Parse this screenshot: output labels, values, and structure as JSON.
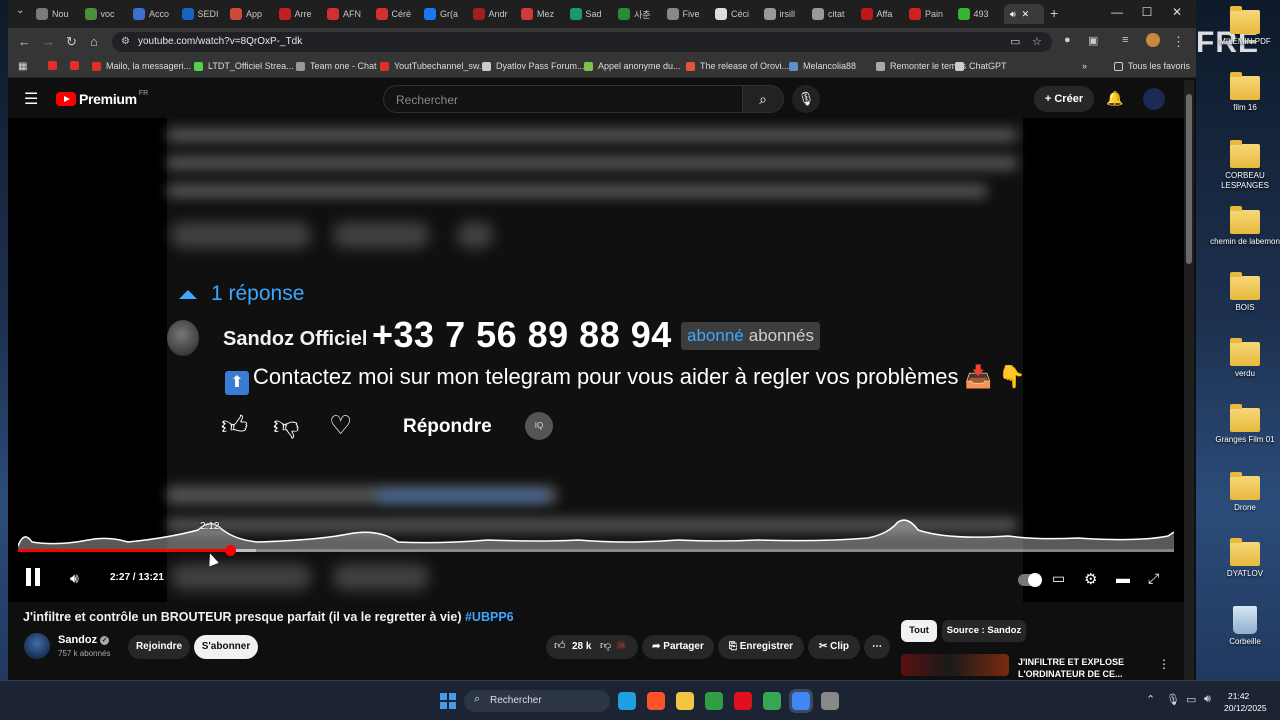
{
  "browser": {
    "tabs": [
      {
        "label": "Nou",
        "color": "#7a7a7a"
      },
      {
        "label": "voc",
        "color": "#4a8f3a"
      },
      {
        "label": "Acco",
        "color": "#3b6fd0"
      },
      {
        "label": "SEDI",
        "color": "#1565c0"
      },
      {
        "label": "App",
        "color": "#d04a3a"
      },
      {
        "label": "Arre",
        "color": "#c02020"
      },
      {
        "label": "AFN",
        "color": "#d03030"
      },
      {
        "label": "Céré",
        "color": "#d03030"
      },
      {
        "label": "Gr(a",
        "color": "#1877f2"
      },
      {
        "label": "Andr",
        "color": "#a02020"
      },
      {
        "label": "Mez",
        "color": "#d03a3a"
      },
      {
        "label": "Sad",
        "color": "#1a9a6a"
      },
      {
        "label": "사춘",
        "color": "#2a8a3a"
      },
      {
        "label": "Five",
        "color": "#888888"
      },
      {
        "label": "Céci",
        "color": "#dddddd"
      },
      {
        "label": "irsill",
        "color": "#999999"
      },
      {
        "label": "citat",
        "color": "#999999"
      },
      {
        "label": "Affa",
        "color": "#c01818"
      },
      {
        "label": "Pain",
        "color": "#d02020"
      },
      {
        "label": "493",
        "color": "#36b530"
      }
    ],
    "url": "youtube.com/watch?v=8QrOxP-_Tdk",
    "bookmarks": [
      {
        "label": "",
        "color": "#e52d27"
      },
      {
        "label": "",
        "color": "#e52d27"
      },
      {
        "label": "Mailo, la messageri...",
        "color": "#e52d27"
      },
      {
        "label": "LTDT_Officiel Strea...",
        "color": "#54d14a"
      },
      {
        "label": "Team one - Chat",
        "color": "#999999"
      },
      {
        "label": "YoutTubechannel_sw...",
        "color": "#e52d27"
      },
      {
        "label": "Dyatlov Pass Forum...",
        "color": "#cccccc"
      },
      {
        "label": "Appel anonyme du...",
        "color": "#7cc24a"
      },
      {
        "label": "The release of Orovi...",
        "color": "#e0553a"
      },
      {
        "label": "Melancolia88",
        "color": "#5a8fd0"
      },
      {
        "label": "Remonter le temps",
        "color": "#aaaaaa"
      },
      {
        "label": "ChatGPT",
        "color": "#cccccc"
      }
    ],
    "all_bookmarks": "Tous les favoris"
  },
  "youtube": {
    "logo": "Premium",
    "region": "FR",
    "search_placeholder": "Rechercher",
    "create_label": "Créer"
  },
  "video": {
    "replies_label": "1 réponse",
    "comment_author": "Sandoz Officiel",
    "phone_overlay": "+33 7 56 89 88 94",
    "sub_badge_a": "abonné",
    "sub_badge_b": "abonnés",
    "comment_text": "Contactez moi sur mon telegram pour vous aider à regler vos problèmes",
    "reply_label": "Répondre",
    "badge_label": "IQ",
    "hover_time": "2:12",
    "time_display": "2:27 / 13:21",
    "progress": {
      "current_seconds": 147,
      "duration_seconds": 801,
      "buffered_seconds": 165
    }
  },
  "watch": {
    "title": "J'infiltre et contrôle un BROUTEUR presque parfait (il va le regretter à vie)",
    "hashtag": "#UBPP6",
    "channel": "Sandoz",
    "subscribers": "757 k abonnés",
    "join_label": "Rejoindre",
    "subscribe_label": "S'abonner",
    "likes": "28 k",
    "dislikes": "2k",
    "share_label": "Partager",
    "save_label": "Enregistrer",
    "clip_label": "Clip",
    "chip_all": "Tout",
    "chip_source": "Source : Sandoz",
    "recommendation_title": "J'INFILTRE ET EXPLOSE L'ORDINATEUR DE CE..."
  },
  "desktop": {
    "watermark": "FRE",
    "icons": [
      {
        "label": "MILEMIN PDF",
        "type": "folder"
      },
      {
        "label": "film 16",
        "type": "folder"
      },
      {
        "label": "CORBEAU LESPANGES",
        "type": "folder"
      },
      {
        "label": "chemin de labemon",
        "type": "folder"
      },
      {
        "label": "BOIS",
        "type": "folder"
      },
      {
        "label": "verdu",
        "type": "folder"
      },
      {
        "label": "Granges Film 01",
        "type": "folder"
      },
      {
        "label": "Drone",
        "type": "folder"
      },
      {
        "label": "DYATLOV",
        "type": "folder"
      },
      {
        "label": "Corbeille",
        "type": "bin"
      }
    ]
  },
  "taskbar": {
    "search_label": "Rechercher",
    "time": "21:42",
    "date": "20/12/2025",
    "apps": [
      {
        "name": "edge",
        "color": "#1fa0e0"
      },
      {
        "name": "brave",
        "color": "#fb542b"
      },
      {
        "name": "explorer",
        "color": "#f4c542"
      },
      {
        "name": "app-green",
        "color": "#2f9e44"
      },
      {
        "name": "opera",
        "color": "#e01020"
      },
      {
        "name": "chrome",
        "color": "#34a853"
      },
      {
        "name": "chrome-active",
        "color": "#4285f4"
      },
      {
        "name": "app-gear",
        "color": "#888888"
      }
    ]
  }
}
